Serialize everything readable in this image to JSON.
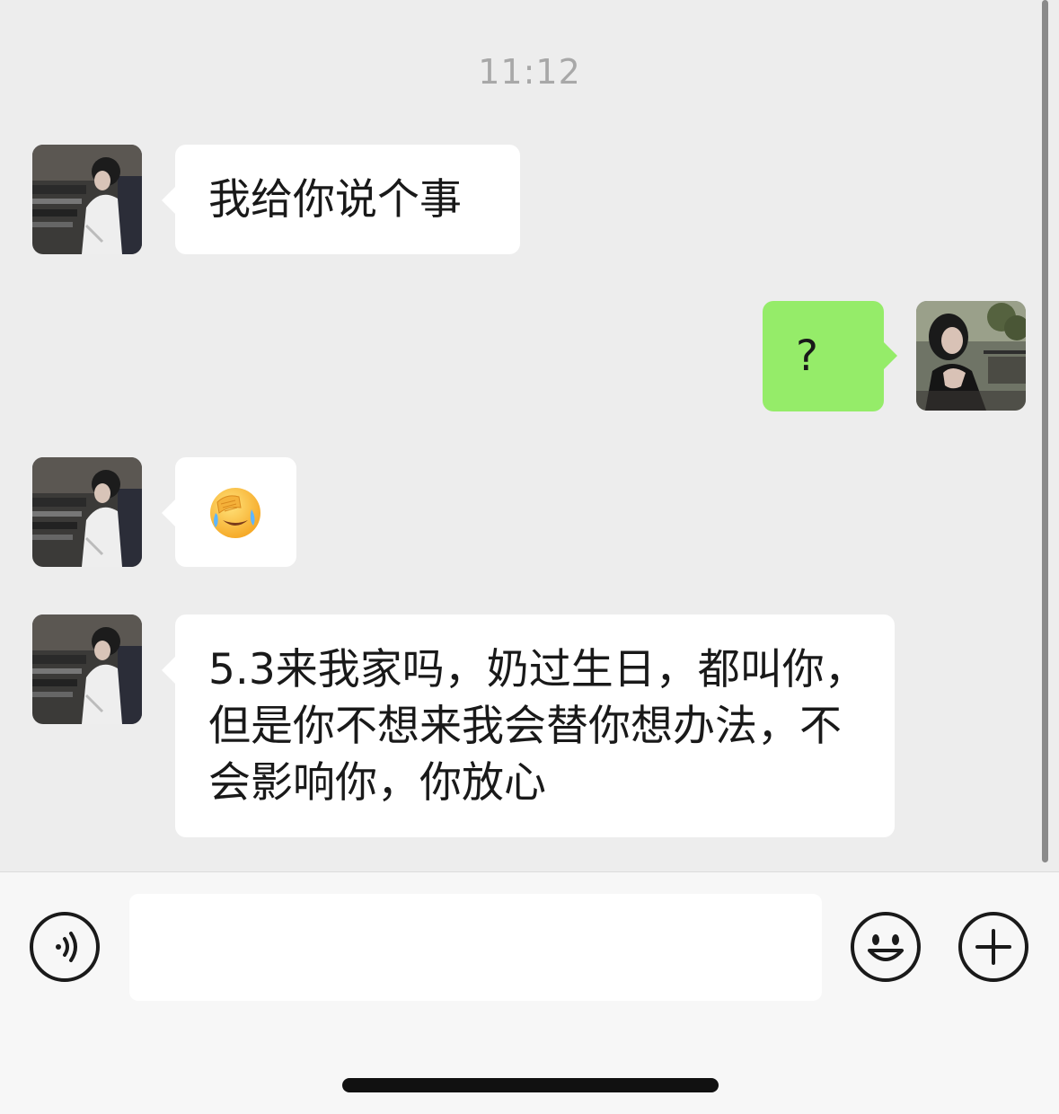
{
  "chat": {
    "timestamp": "11:12",
    "messages": [
      {
        "sender": "other",
        "type": "text",
        "text": "我给你说个事"
      },
      {
        "sender": "self",
        "type": "text",
        "text": "?"
      },
      {
        "sender": "other",
        "type": "emoji",
        "emoji": "facepalm-laugh-emoji"
      },
      {
        "sender": "other",
        "type": "text",
        "text": "5.3来我家吗，奶过生日，都叫你，但是你不想来我会替你想办法，不会影响你，你放心"
      }
    ]
  },
  "input_bar": {
    "voice_icon": "voice-icon",
    "emoji_icon": "smiley-icon",
    "plus_icon": "plus-icon",
    "input_value": ""
  },
  "colors": {
    "chat_background": "#ededed",
    "incoming_bubble": "#ffffff",
    "outgoing_bubble": "#95ec69",
    "input_bar_background": "#f7f7f7"
  }
}
